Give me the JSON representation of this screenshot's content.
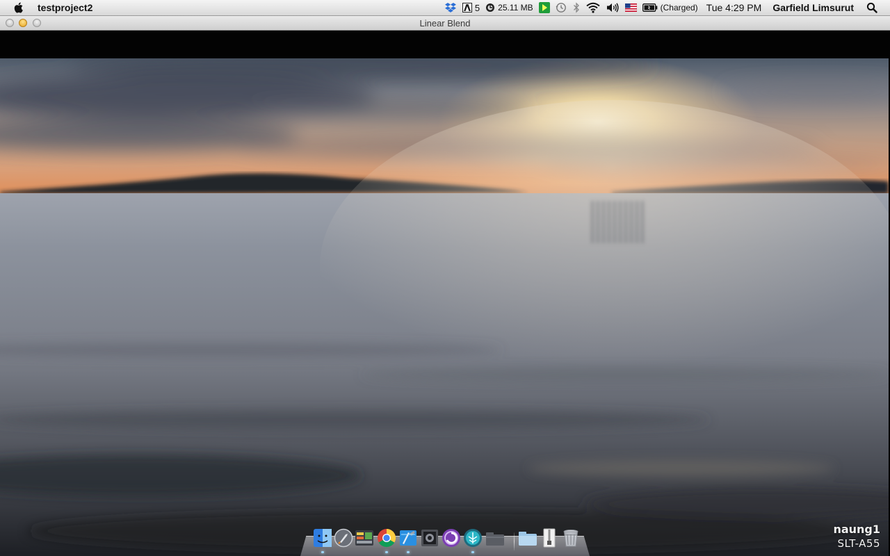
{
  "menubar": {
    "app_name": "testproject2",
    "adobe_count": "5",
    "memory": "25.11 MB",
    "battery_status": "(Charged)",
    "clock": "Tue 4:29 PM",
    "user": "Garfield Limsurut",
    "status_icons": [
      "dropbox-icon",
      "adobe-icon",
      "memory-clean-icon",
      "spark-icon",
      "time-machine-icon",
      "bluetooth-icon",
      "wifi-icon",
      "volume-icon",
      "us-flag-icon",
      "battery-icon",
      "spotlight-icon"
    ]
  },
  "window": {
    "title": "Linear Blend"
  },
  "watermark": {
    "line1": "naung1",
    "line2": "SLT-A55"
  },
  "dock": {
    "items": [
      "finder-icon",
      "launchpad-icon",
      "system-monitor-icon",
      "chrome-icon",
      "xcode-icon",
      "photo-booth-icon",
      "app-purple-icon",
      "app-teal-icon",
      "folder-dark-icon",
      "folder-icon",
      "archive-icon",
      "trash-icon"
    ],
    "running": [
      "finder-icon",
      "chrome-icon",
      "xcode-icon",
      "app-teal-icon"
    ]
  },
  "colors": {
    "sky_top": "#5a6675",
    "sun": "#fff3c8",
    "horizon_glow": "#e8935a",
    "water": "#8a8f99",
    "watermark": "#f2f2f2"
  }
}
